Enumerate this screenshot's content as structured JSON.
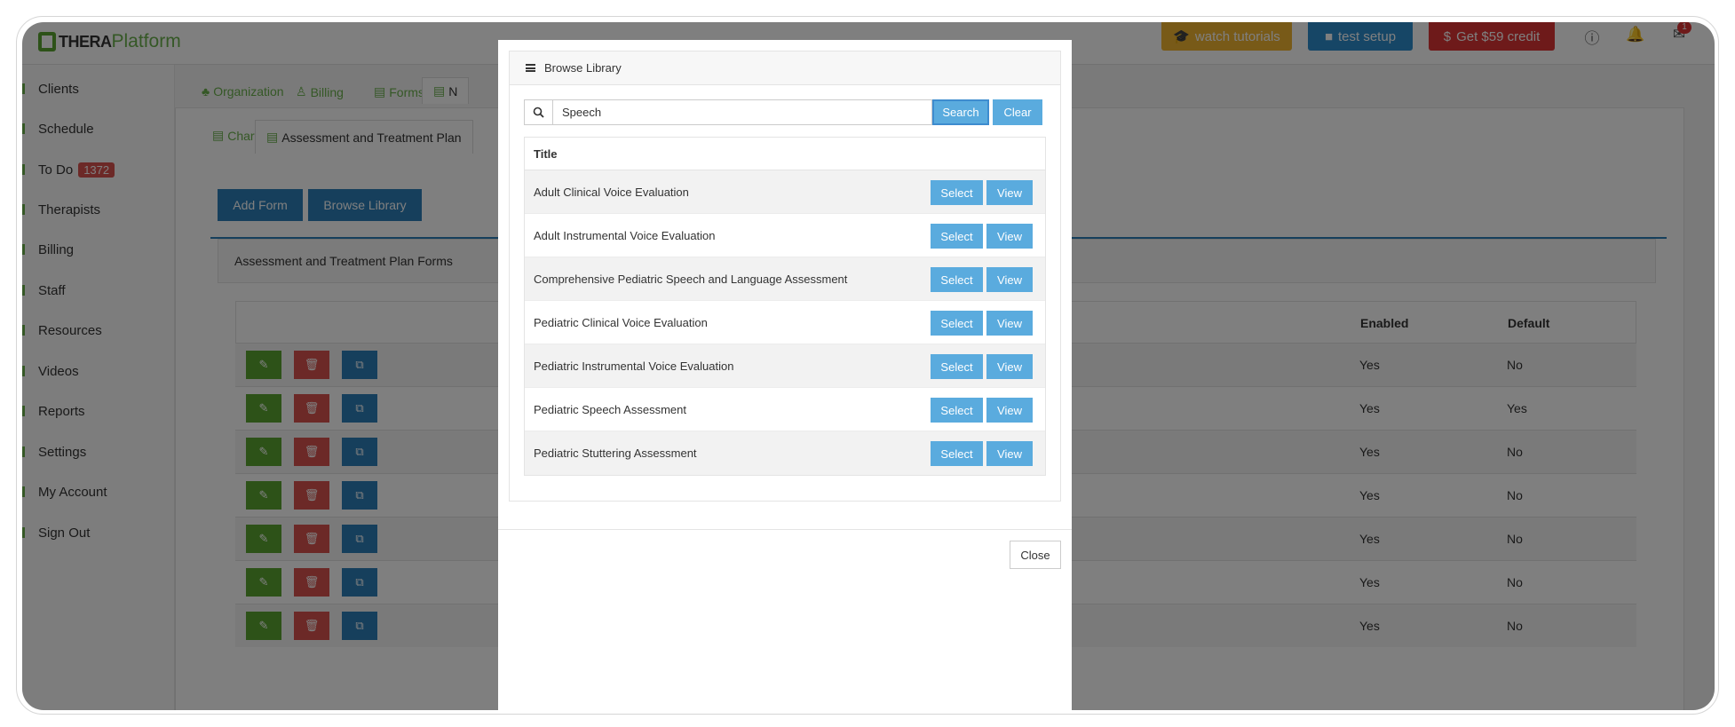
{
  "app": {
    "logo_thera": "THERA",
    "logo_platform": "Platform"
  },
  "topbar": {
    "watch_tutorials": "watch tutorials",
    "test_setup": "test setup",
    "get_credit": "Get $59 credit",
    "notification_count": "1"
  },
  "sidebar": {
    "items": [
      {
        "label": "Clients"
      },
      {
        "label": "Schedule"
      },
      {
        "label": "To Do",
        "badge": "1372"
      },
      {
        "label": "Therapists"
      },
      {
        "label": "Billing"
      },
      {
        "label": "Staff"
      },
      {
        "label": "Resources"
      },
      {
        "label": "Videos"
      },
      {
        "label": "Reports"
      },
      {
        "label": "Settings"
      },
      {
        "label": "My Account"
      },
      {
        "label": "Sign Out"
      }
    ]
  },
  "main": {
    "tabs": [
      "Organization",
      "Billing",
      "Forms",
      "N"
    ],
    "subtabs": [
      "Chart",
      "Assessment and Treatment Plan"
    ],
    "add_form": "Add Form",
    "browse_library": "Browse Library",
    "panel_title": "Assessment and Treatment Plan Forms",
    "col_enabled": "Enabled",
    "col_default": "Default",
    "rows": [
      {
        "enabled": "Yes",
        "default": "No"
      },
      {
        "enabled": "Yes",
        "default": "Yes"
      },
      {
        "enabled": "Yes",
        "default": "No"
      },
      {
        "enabled": "Yes",
        "default": "No"
      },
      {
        "enabled": "Yes",
        "default": "No"
      },
      {
        "enabled": "Yes",
        "default": "No"
      },
      {
        "enabled": "Yes",
        "default": "No"
      }
    ]
  },
  "modal": {
    "title": "Browse Library",
    "search_value": "Speech",
    "search_button": "Search",
    "clear_button": "Clear",
    "column_title": "Title",
    "select_label": "Select",
    "view_label": "View",
    "items": [
      {
        "title": "Adult Clinical Voice Evaluation"
      },
      {
        "title": "Adult Instrumental Voice Evaluation"
      },
      {
        "title": "Comprehensive Pediatric Speech and Language Assessment"
      },
      {
        "title": "Pediatric Clinical Voice Evaluation"
      },
      {
        "title": "Pediatric Instrumental Voice Evaluation"
      },
      {
        "title": "Pediatric Speech Assessment"
      },
      {
        "title": "Pediatric Stuttering Assessment"
      }
    ],
    "close_button": "Close"
  },
  "colors": {
    "brand_green": "#6ab04c",
    "primary_blue": "#2d7fb8",
    "modal_button_blue": "#5aabde",
    "danger_red": "#d9534f",
    "warning_yellow": "#f0b431"
  }
}
